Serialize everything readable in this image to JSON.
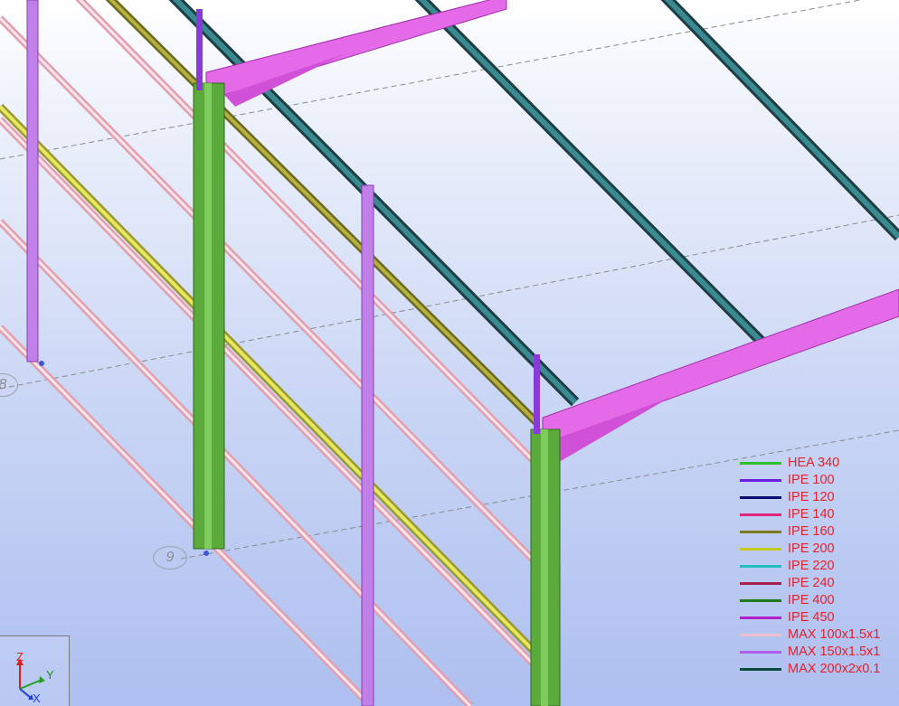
{
  "grid_labels": {
    "label_8": "8",
    "label_9": "9"
  },
  "legend": {
    "items": [
      {
        "label": "HEA 340",
        "color": "#2fbf2f"
      },
      {
        "label": "IPE 100",
        "color": "#6a1fe0"
      },
      {
        "label": "IPE 120",
        "color": "#0a0a6e"
      },
      {
        "label": "IPE 140",
        "color": "#e0257a"
      },
      {
        "label": "IPE 160",
        "color": "#7d7a1f"
      },
      {
        "label": "IPE 200",
        "color": "#c8c820"
      },
      {
        "label": "IPE 220",
        "color": "#1fbfbf"
      },
      {
        "label": "IPE 240",
        "color": "#a81f4a"
      },
      {
        "label": "IPE 400",
        "color": "#1f7a1f"
      },
      {
        "label": "IPE 450",
        "color": "#b01fc8"
      },
      {
        "label": "MAX 100x1.5x1",
        "color": "#f0c0cc"
      },
      {
        "label": "MAX 150x1.5x1",
        "color": "#b060e8"
      },
      {
        "label": "MAX 200x2x0.1",
        "color": "#0a4a3a"
      }
    ]
  },
  "axes": {
    "z": "Z",
    "y": "Y",
    "x": "X"
  },
  "colors": {
    "column": "#5aaa3c",
    "post": "#c080e8",
    "purlin_pink": "#f2c8d2",
    "roof_purlin": "#2e6a72",
    "rafter": "#e46ae8",
    "girt_yellow": "#d8d850",
    "girt_olive": "#8c8c2c",
    "brace": "#8a3ad8"
  }
}
